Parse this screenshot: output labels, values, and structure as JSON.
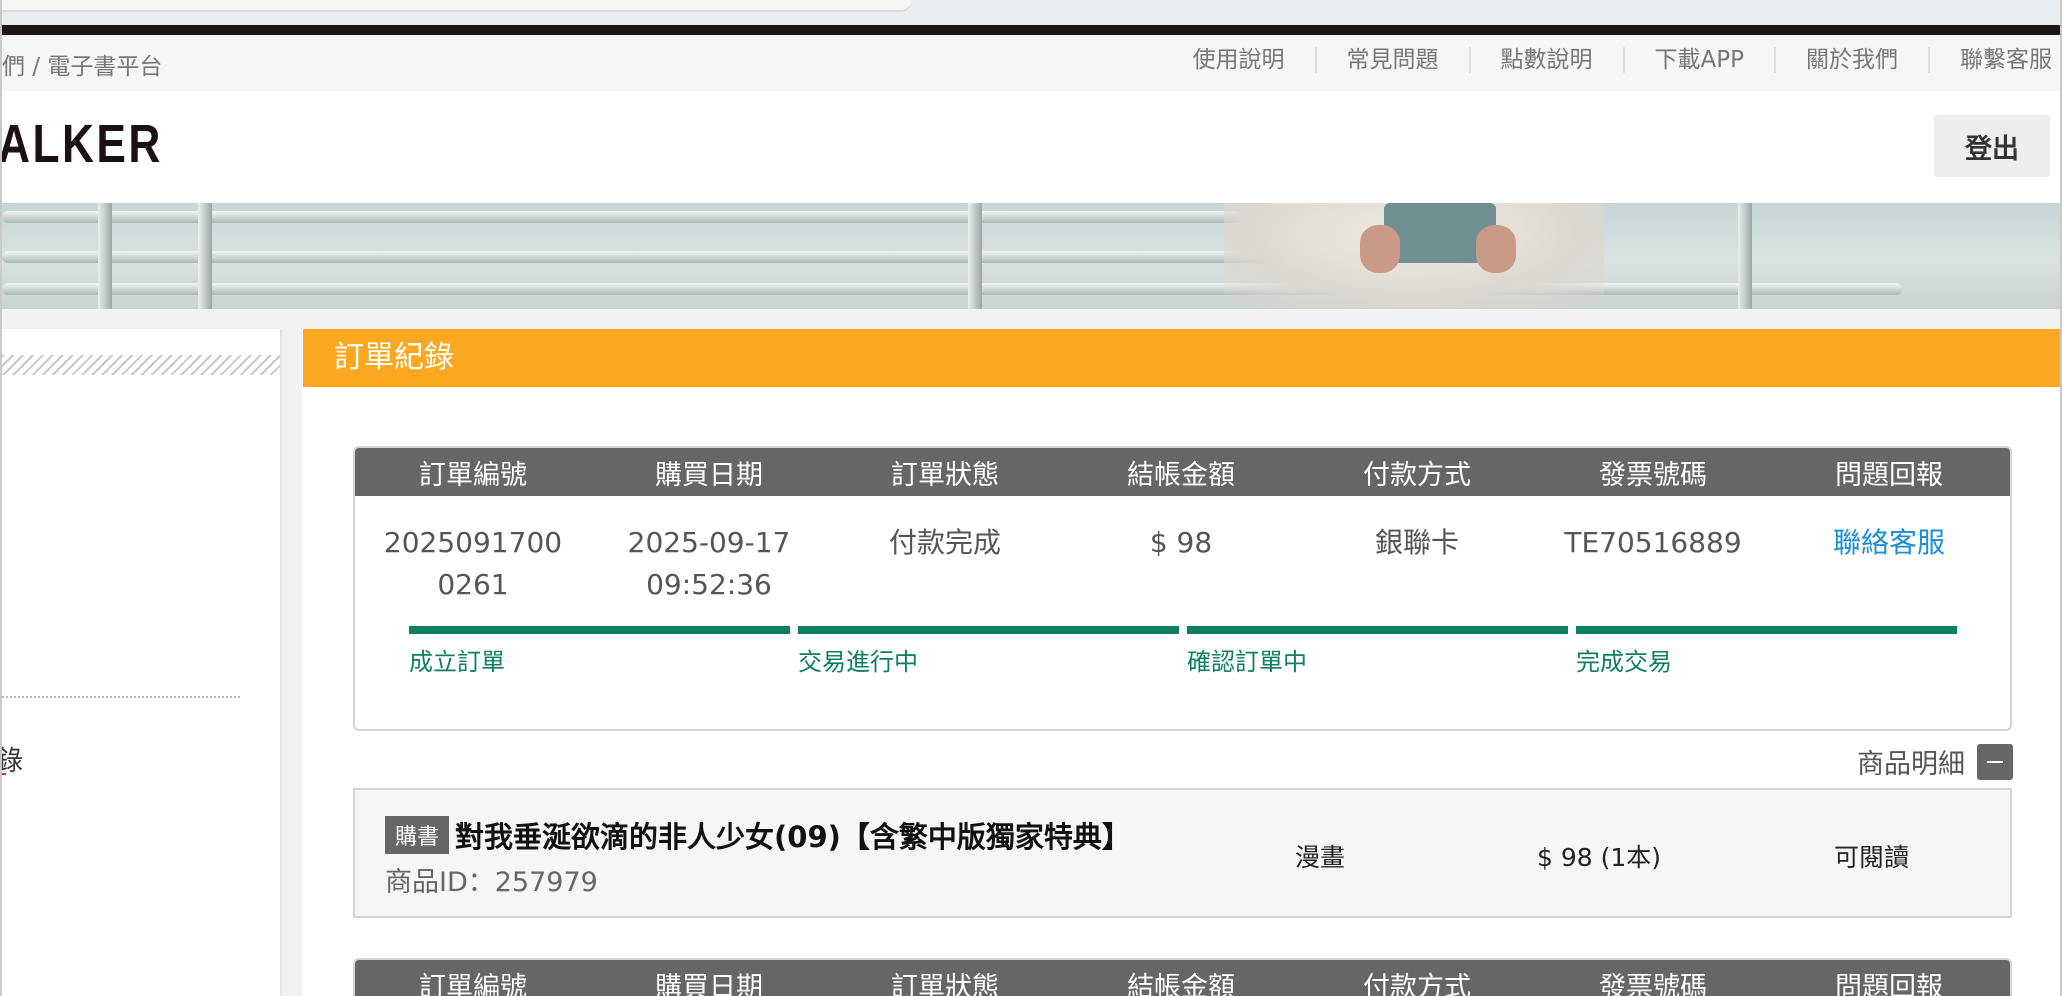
{
  "breadcrumb": "們 / 電子書平台",
  "topnav": [
    "使用說明",
    "常見問題",
    "點數說明",
    "下載APP",
    "關於我們",
    "聯繫客服"
  ],
  "logo": "ALKER",
  "logout_label": "登出",
  "sidebar": {
    "partial_label": "錄"
  },
  "panel_title": "訂單紀錄",
  "order_columns": [
    "訂單編號",
    "購買日期",
    "訂單狀態",
    "結帳金額",
    "付款方式",
    "發票號碼",
    "問題回報"
  ],
  "orders": [
    {
      "order_no_line1": "2025091700",
      "order_no_line2": "0261",
      "date": "2025-09-17",
      "time": "09:52:36",
      "status": "付款完成",
      "amount": "$ 98",
      "payment": "銀聯卡",
      "invoice": "TE70516889",
      "report_link": "聯絡客服"
    }
  ],
  "progress_steps": [
    "成立訂單",
    "交易進行中",
    "確認訂單中",
    "完成交易"
  ],
  "detail_toggle_label": "商品明細",
  "item": {
    "tag": "購書",
    "title": "對我垂涎欲滴的非人少女(09)【含繁中版獨家特典】",
    "product_id": "商品ID：257979",
    "category": "漫畫",
    "price": "$ 98 (1本)",
    "status": "可閱讀"
  },
  "colors": {
    "accent": "#fba820",
    "header_gray": "#666666",
    "progress_green": "#0e7f5f",
    "link_blue": "#1a8ed6"
  }
}
